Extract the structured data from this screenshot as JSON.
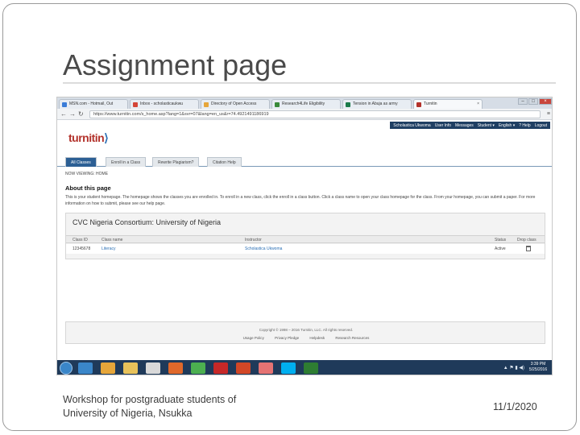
{
  "slide": {
    "title": "Assignment page",
    "footer_line1": "Workshop for postgraduate students of",
    "footer_line2": "University of Nigeria, Nsukka",
    "date": "11/1/2020"
  },
  "browser": {
    "tabs": [
      {
        "label": "MSN.com - Hotmail, Out",
        "color": "#3b7dd8"
      },
      {
        "label": "Inbox - scholasticaukwu",
        "color": "#d44638"
      },
      {
        "label": "Directory of Open Access",
        "color": "#e6a63a"
      },
      {
        "label": "Research4Life Eligibility",
        "color": "#3a8a3a"
      },
      {
        "label": "Tension in Abuja as army",
        "color": "#1a7a4a"
      },
      {
        "label": "Turnitin",
        "color": "#b3322b"
      }
    ],
    "url": "https://www.turnitin.com/s_home.asp?lang=1&svr=07&lang=en_us&r=74.4921491186919",
    "window_buttons": [
      "–",
      "□",
      "×"
    ]
  },
  "turnitin": {
    "logo_text": "turnitin",
    "user_nav": [
      "Scholastica Ukwoma",
      "User Info",
      "Messages",
      "Student ▾",
      "English ▾",
      "? Help",
      "Logout"
    ],
    "tabs": [
      "All Classes",
      "Enroll in a Class",
      "Rewrite Plagiarism?",
      "Citation Help"
    ],
    "breadcrumb": "NOW VIEWING: HOME",
    "about_heading": "About this page",
    "about_text": "This is your student homepage. The homepage shows the classes you are enrolled in. To enroll in a new class, click the enroll in a class button. Click a class name to open your class homepage for the class. From your homepage, you can submit a paper. For more information on how to submit, please see our help page.",
    "class_group_title": "CVC Nigeria Consortium: University of Nigeria",
    "table_headers": [
      "Class ID",
      "Class name",
      "Instructor",
      "Status",
      "Drop class"
    ],
    "rows": [
      {
        "class_id": "12345678",
        "class_name": "Literacy",
        "instructor": "Scholastica Ukwoma",
        "status": "Active"
      }
    ],
    "copyright": "Copyright © 1998 – 2016 Turnitin, LLC. All rights reserved.",
    "footer_links": [
      "Usage Policy",
      "Privacy Pledge",
      "Helpdesk",
      "Research Resources"
    ]
  },
  "taskbar": {
    "icons": [
      {
        "name": "ie-icon",
        "color": "#3a86c9"
      },
      {
        "name": "media-player-icon",
        "color": "#e6a63a"
      },
      {
        "name": "folder-icon",
        "color": "#e8c25a"
      },
      {
        "name": "notes-icon",
        "color": "#d9d9d9"
      },
      {
        "name": "firefox-icon",
        "color": "#e0682a"
      },
      {
        "name": "chrome-icon",
        "color": "#4caf50"
      },
      {
        "name": "acrobat-icon",
        "color": "#c62828"
      },
      {
        "name": "powerpoint-icon",
        "color": "#d24726"
      },
      {
        "name": "paint-icon",
        "color": "#e57373"
      },
      {
        "name": "skype-icon",
        "color": "#00aff0"
      },
      {
        "name": "excel-icon",
        "color": "#2e7d32"
      }
    ],
    "time": "3:39 PM",
    "date": "5/25/2016"
  }
}
